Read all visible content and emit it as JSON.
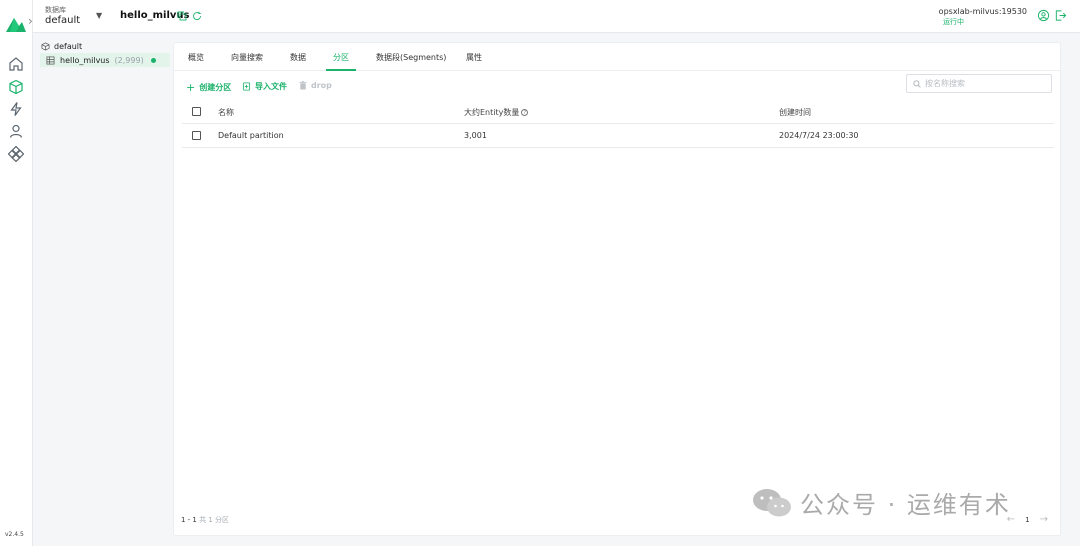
{
  "app": {
    "version": "v2.4.5",
    "database_label": "数据库",
    "database_value": "default",
    "collection_title": "hello_milvus",
    "connection_address": "opsxlab-milvus:19530",
    "connection_status": "运行中"
  },
  "tree": {
    "database": "default",
    "collection_name": "hello_milvus",
    "collection_count": "(2,999)"
  },
  "tabs": [
    {
      "label": "概览"
    },
    {
      "label": "向量搜索"
    },
    {
      "label": "数据"
    },
    {
      "label": "分区"
    },
    {
      "label": "数据段(Segments)"
    },
    {
      "label": "属性"
    }
  ],
  "active_tab": "分区",
  "toolbar": {
    "create_partition": "创建分区",
    "import_file": "导入文件",
    "drop": "drop"
  },
  "search": {
    "placeholder": "按名称搜索"
  },
  "table": {
    "headers": [
      "名称",
      "大约Entity数量",
      "创建时间"
    ],
    "rows": [
      {
        "name": "Default partition",
        "entities": "3,001",
        "created": "2024/7/24 23:00:30"
      }
    ]
  },
  "footer": {
    "range": "1 - 1",
    "total": "共 1 分区",
    "page": "1"
  },
  "watermark": {
    "text": "公众号 · 运维有术"
  },
  "colors": {
    "accent": "#1bb26b",
    "selected_bg": "#e3f4ea"
  }
}
